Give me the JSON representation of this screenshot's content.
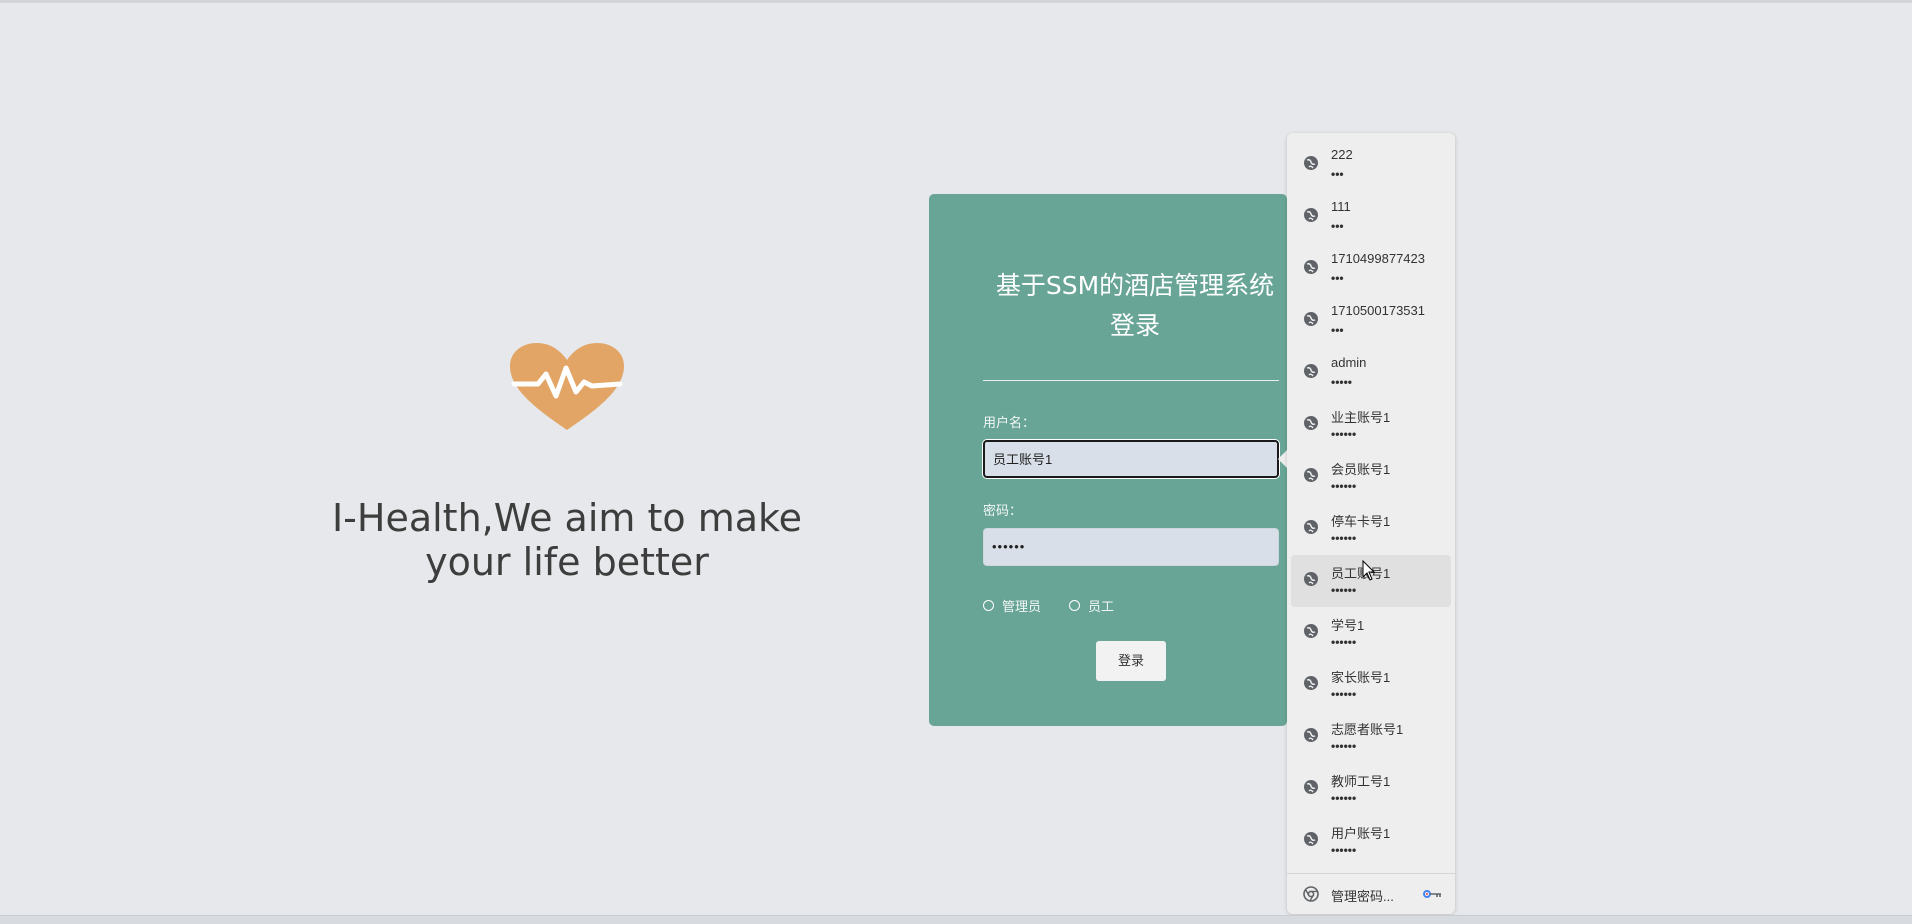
{
  "branding": {
    "logo_icon": "heart-pulse-icon",
    "slogan_line1": "I-Health,We aim to make",
    "slogan_line2": "your life better",
    "logo_color": "#e2a565"
  },
  "login": {
    "title_line1": "基于SSM的酒店管理系统",
    "title_line2": "登录",
    "username_label": "用户名：",
    "username_value": "员工账号1",
    "password_label": "密码：",
    "password_value": "••••••",
    "roles": [
      "管理员",
      "员工"
    ],
    "submit_label": "登录",
    "card_color": "#68a596"
  },
  "autofill": {
    "items": [
      {
        "user": "222",
        "pass": "•••"
      },
      {
        "user": "111",
        "pass": "•••"
      },
      {
        "user": "1710499877423",
        "pass": "•••"
      },
      {
        "user": "1710500173531",
        "pass": "•••"
      },
      {
        "user": "admin",
        "pass": "•••••"
      },
      {
        "user": "业主账号1",
        "pass": "••••••"
      },
      {
        "user": "会员账号1",
        "pass": "••••••"
      },
      {
        "user": "停车卡号1",
        "pass": "••••••"
      },
      {
        "user": "员工账号1",
        "pass": "••••••"
      },
      {
        "user": "学号1",
        "pass": "••••••"
      },
      {
        "user": "家长账号1",
        "pass": "••••••"
      },
      {
        "user": "志愿者账号1",
        "pass": "••••••"
      },
      {
        "user": "教师工号1",
        "pass": "••••••"
      },
      {
        "user": "用户账号1",
        "pass": "••••••"
      }
    ],
    "item_icon": "globe-icon",
    "manage_label": "管理密码...",
    "manage_icon": "chrome-icon",
    "key_icon": "key-icon"
  }
}
